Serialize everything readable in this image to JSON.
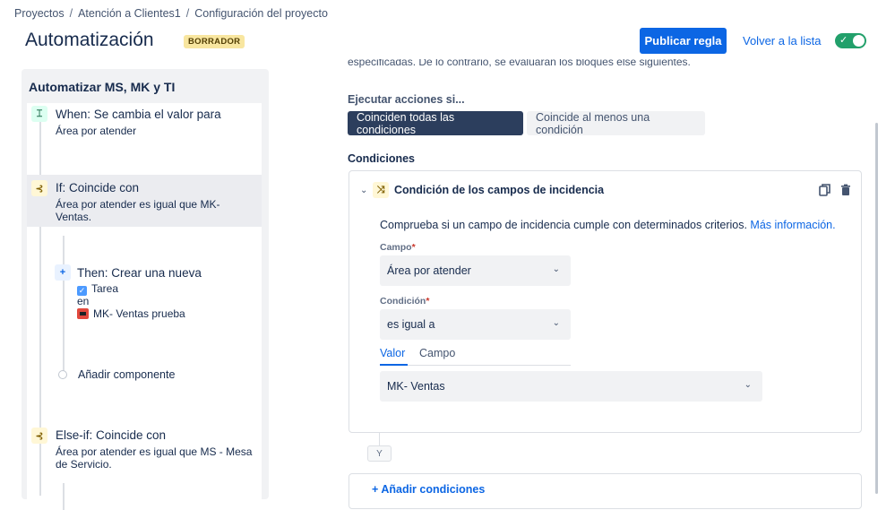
{
  "breadcrumbs": [
    "Proyectos",
    "Atención a Clientes1",
    "Configuración del proyecto"
  ],
  "header": {
    "title": "Automatización",
    "status_badge": "BORRADOR",
    "publish_label": "Publicar regla",
    "back_label": "Volver a la lista",
    "toggle_state": "on"
  },
  "sidebar": {
    "title": "Automatizar MS,  MK y TI",
    "items": [
      {
        "type": "when",
        "heading": "When: Se cambia el valor para",
        "sub": "Área por atender"
      },
      {
        "type": "if",
        "heading": "If: Coincide con",
        "sub1": "Área por atender es igual que MK-",
        "sub2": "Ventas."
      },
      {
        "type": "then",
        "heading": "Then: Crear una nueva",
        "line1": "Tarea",
        "line2": "en",
        "line3": "MK- Ventas prueba"
      },
      {
        "type": "add",
        "label": "Añadir componente"
      },
      {
        "type": "elseif",
        "heading": "Else-if: Coincide con",
        "sub1": "Área por atender es igual que MS - Mesa",
        "sub2": "de Servicio."
      }
    ]
  },
  "main": {
    "cut_text": "especificadas. De lo contrario, se evaluarán los bloques else siguientes.",
    "execute_label": "Ejecutar acciones si...",
    "segments": {
      "all": "Coinciden todas las condiciones",
      "any": "Coincide al menos una condición"
    },
    "conditions_label": "Condiciones",
    "card": {
      "title": "Condición de los campos de incidencia",
      "description": "Comprueba si un campo de incidencia cumple con determinados criterios.",
      "more_link": "Más información.",
      "field_label": "Campo",
      "field_value": "Área por atender",
      "condition_label": "Condición",
      "condition_value": "es igual a",
      "tabs": {
        "value": "Valor",
        "field": "Campo"
      },
      "value_select": "MK- Ventas"
    },
    "and_label": "Y",
    "add_conditions": "Añadir condiciones"
  }
}
